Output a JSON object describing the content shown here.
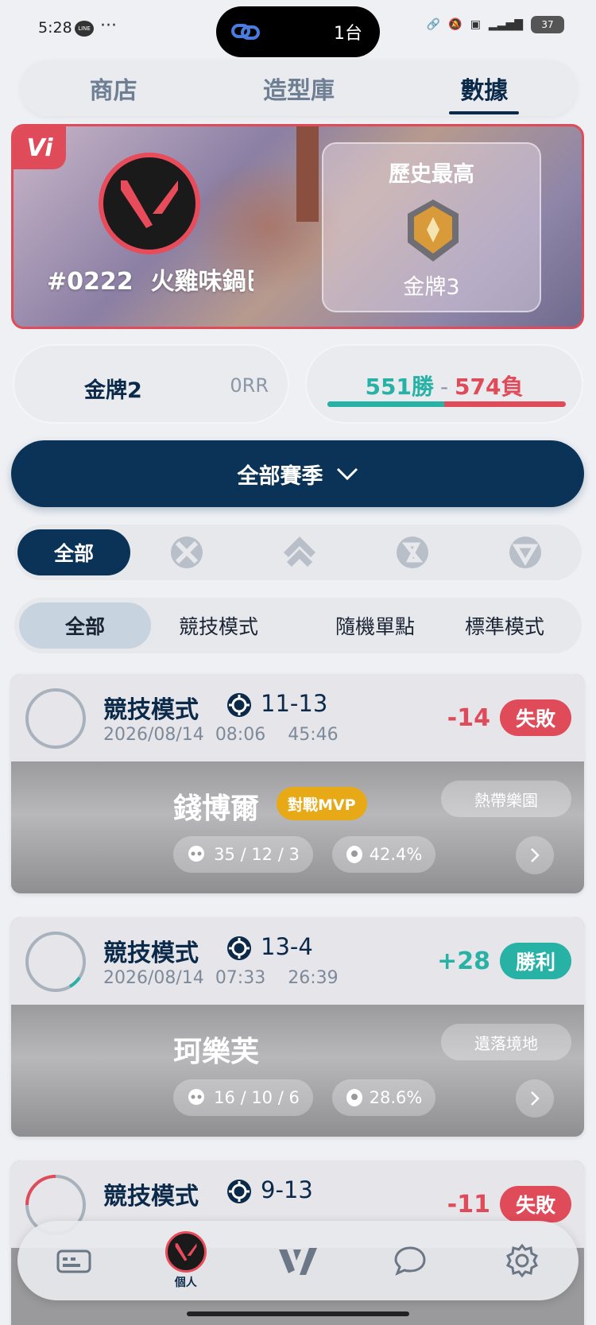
{
  "status_bar": {
    "time": "5:28",
    "line_label": "LINE",
    "more": "···",
    "island_text": "1台",
    "battery": "37"
  },
  "top_tabs": [
    {
      "label": "商店",
      "active": false
    },
    {
      "label": "造型庫",
      "active": false
    },
    {
      "label": "數據",
      "active": true
    }
  ],
  "profile": {
    "logo": "Vi",
    "tag": "#0222",
    "name": "火雞味鍋巴",
    "best_label": "歷史最高",
    "best_rank": "金牌3"
  },
  "current": {
    "rank": "金牌2",
    "rr": "0RR",
    "wins": "551勝",
    "separator": "-",
    "losses": "574負",
    "win_ratio": 0.49
  },
  "season_button": {
    "label": "全部賽季"
  },
  "role_filter": {
    "all_label": "全部",
    "roles": [
      "sentinel-icon",
      "initiator-icon",
      "controller-icon",
      "duelist-icon"
    ]
  },
  "mode_filter": [
    {
      "label": "全部",
      "active": true
    },
    {
      "label": "競技模式",
      "active": false
    },
    {
      "label": "隨機單點",
      "active": false
    },
    {
      "label": "標準模式",
      "active": false
    }
  ],
  "matches": [
    {
      "mode": "競技模式",
      "score": "11-13",
      "date": "2026/08/14",
      "time": "08:06",
      "duration": "45:46",
      "rr_change": "-14",
      "result": "失敗",
      "result_type": "loss",
      "agent": "錢博爾",
      "mvp": "對戰MVP",
      "map": "熱帶樂園",
      "kda": "35 / 12 / 3",
      "hs": "42.4%",
      "ring_progress": 0.0
    },
    {
      "mode": "競技模式",
      "score": "13-4",
      "date": "2026/08/14",
      "time": "07:33",
      "duration": "26:39",
      "rr_change": "+28",
      "result": "勝利",
      "result_type": "win",
      "agent": "珂樂芙",
      "mvp": "",
      "map": "遺落境地",
      "kda": "16 / 10 / 6",
      "hs": "28.6%",
      "ring_progress": 0.1
    },
    {
      "mode": "競技模式",
      "score": "9-13",
      "rr_change": "-11",
      "result": "失敗",
      "result_type": "loss"
    }
  ],
  "bottom_nav": {
    "items": [
      {
        "icon": "inventory-icon",
        "label": ""
      },
      {
        "icon": "profile-avatar-icon",
        "label": "個人"
      },
      {
        "icon": "vi-logo-icon",
        "label": ""
      },
      {
        "icon": "chat-icon",
        "label": ""
      },
      {
        "icon": "settings-icon",
        "label": ""
      }
    ]
  },
  "colors": {
    "navy": "#0b3357",
    "win": "#27b2a5",
    "loss": "#e04b5a",
    "mvp": "#e7a916"
  }
}
